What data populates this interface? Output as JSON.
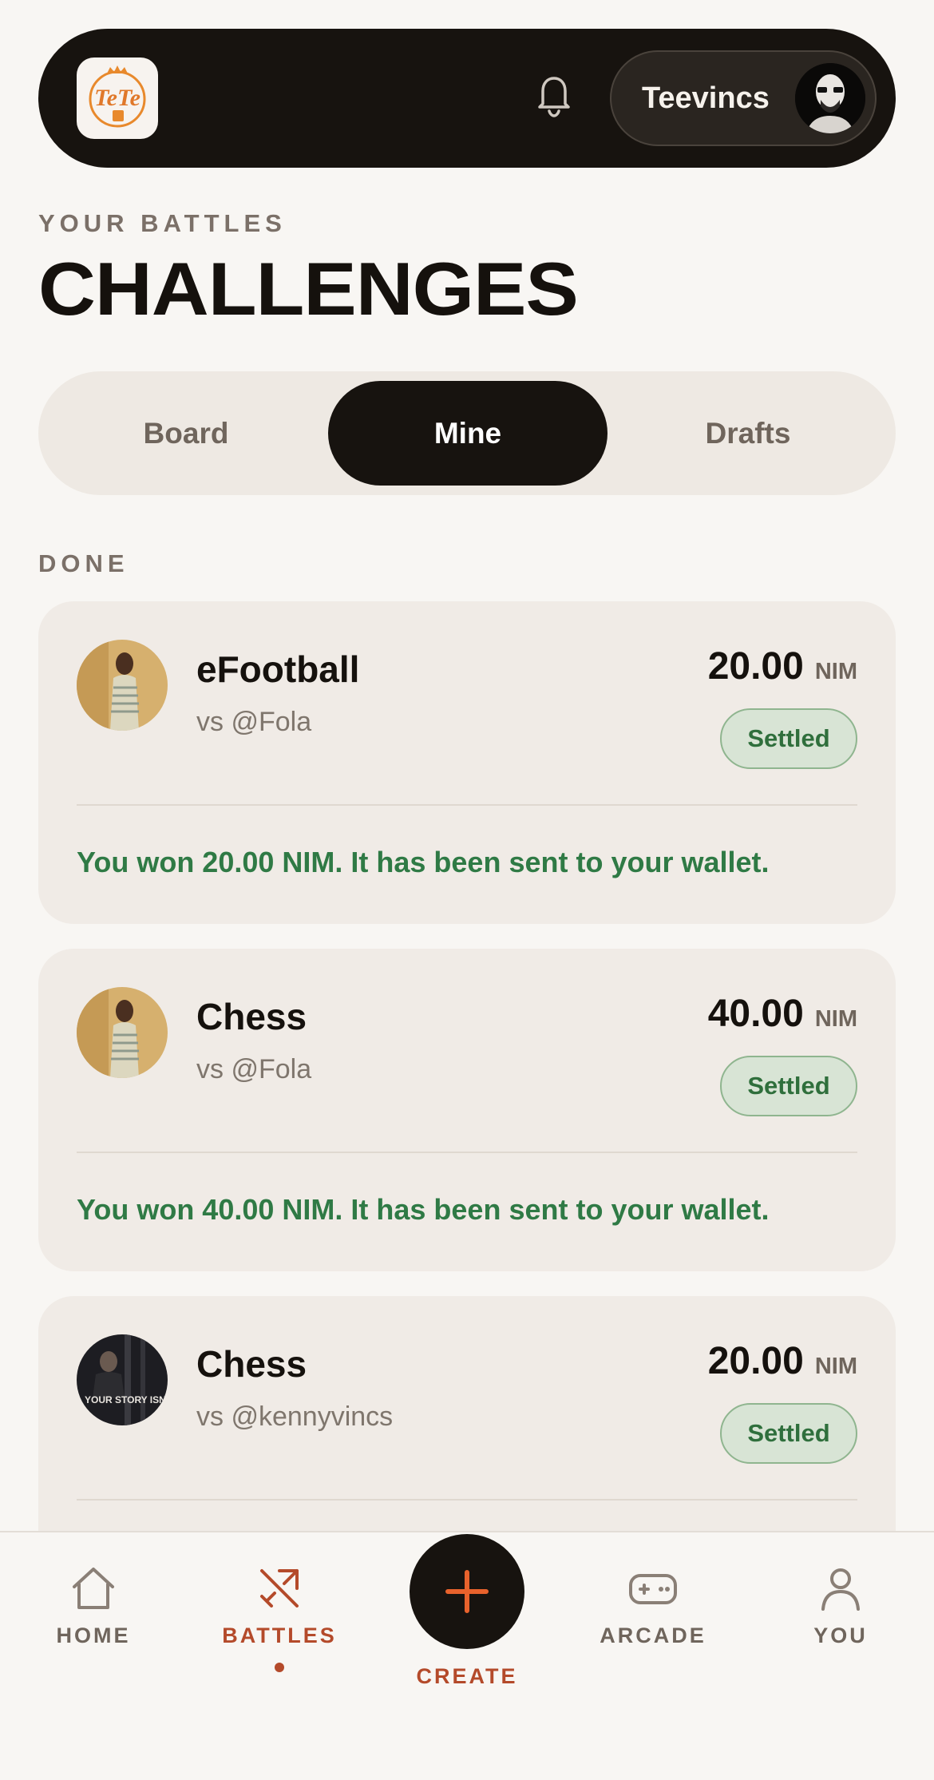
{
  "header": {
    "logo_text": "TeTe",
    "username": "Teevincs",
    "icons": {
      "notifications": "bell-icon",
      "avatar": "user-avatar"
    }
  },
  "page": {
    "eyebrow": "YOUR BATTLES",
    "title": "CHALLENGES"
  },
  "tabs": [
    {
      "label": "Board",
      "active": false
    },
    {
      "label": "Mine",
      "active": true
    },
    {
      "label": "Drafts",
      "active": false
    }
  ],
  "section": {
    "label": "DONE"
  },
  "challenges": [
    {
      "game": "eFootball",
      "opponent": "vs @Fola",
      "amount": "20.00",
      "unit": "NIM",
      "status": "Settled",
      "message": "You won 20.00 NIM. It has been sent to your wallet."
    },
    {
      "game": "Chess",
      "opponent": "vs @Fola",
      "amount": "40.00",
      "unit": "NIM",
      "status": "Settled",
      "message": "You won 40.00 NIM. It has been sent to your wallet."
    },
    {
      "game": "Chess",
      "opponent": "vs @kennyvincs",
      "amount": "20.00",
      "unit": "NIM",
      "status": "Settled",
      "avatar_text": "YOUR STORY ISN'T OVER."
    }
  ],
  "nav": {
    "home": "HOME",
    "battles": "BATTLES",
    "create": "CREATE",
    "arcade": "ARCADE",
    "you": "YOU",
    "active": "battles"
  },
  "colors": {
    "background": "#f8f6f3",
    "dark": "#17130f",
    "accent": "#b44a2a",
    "create_plus": "#e8622c",
    "won_text": "#2f7a45",
    "settled_bg": "#d8e4d5"
  }
}
